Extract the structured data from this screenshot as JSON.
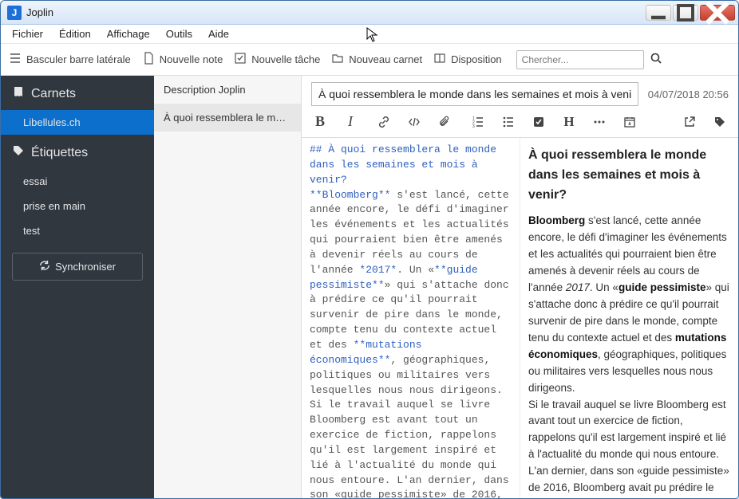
{
  "window": {
    "title": "Joplin"
  },
  "menu": {
    "file": "Fichier",
    "edit": "Édition",
    "view": "Affichage",
    "tools": "Outils",
    "help": "Aide"
  },
  "toolbar": {
    "toggle_sidebar": "Basculer barre latérale",
    "new_note": "Nouvelle note",
    "new_task": "Nouvelle tâche",
    "new_notebook": "Nouveau carnet",
    "layout": "Disposition",
    "search_placeholder": "Chercher..."
  },
  "sidebar": {
    "notebooks_label": "Carnets",
    "notebooks": [
      {
        "label": "Libellules.ch",
        "active": true
      }
    ],
    "tags_label": "Étiquettes",
    "tags": [
      {
        "label": "essai"
      },
      {
        "label": "prise en main"
      },
      {
        "label": "test"
      }
    ],
    "sync_label": "Synchroniser"
  },
  "notelist": {
    "items": [
      {
        "label": "Description Joplin",
        "selected": false
      },
      {
        "label": "À quoi ressemblera le monde dans",
        "selected": true
      }
    ]
  },
  "note": {
    "title": "À quoi ressemblera le monde dans les semaines et mois à venir?",
    "timestamp": "04/07/2018 20:56",
    "md_heading": "## À quoi ressemblera le monde dans les semaines et mois à venir?",
    "md_line1a": "**Bloomberg**",
    "md_line1b": " s'est lancé, cette année encore, le défi d'imaginer les événements et les actualités qui pourraient bien être amenés à devenir réels au cours de l'année ",
    "md_line1c": "*2017*",
    "md_line1d": ". Un «",
    "md_line1e": "**guide pessimiste**",
    "md_line1f": "» qui s'attache donc à prédire ce qu'il pourrait survenir de pire dans le monde, compte tenu du contexte actuel et des ",
    "md_line1g": "**mutations économiques**",
    "md_line1h": ", géographiques, politiques ou militaires vers lesquelles nous nous dirigeons.",
    "md_line2": "Si le travail auquel se livre Bloomberg est avant tout un exercice de fiction, rappelons qu'il est largement inspiré et lié à l'actualité du monde qui nous entoure. L'an dernier, dans son «guide pessimiste» de 2016,",
    "r_heading": "À quoi ressemblera le monde dans les semaines et mois à venir?",
    "r_p1_a": "Bloomberg",
    "r_p1_b": " s'est lancé, cette année encore, le défi d'imaginer les événements et les actualités qui pourraient bien être amenés à devenir réels au cours de l'année ",
    "r_p1_c": "2017",
    "r_p1_d": ". Un «",
    "r_p1_e": "guide pessimiste",
    "r_p1_f": "» qui s'attache donc à prédire ce qu'il pourrait survenir de pire dans le monde, compte tenu du contexte actuel et des ",
    "r_p1_g": "mutations économiques",
    "r_p1_h": ", géographiques, politiques ou militaires vers lesquelles nous nous dirigeons.",
    "r_p2": "Si le travail auquel se livre Bloomberg est avant tout un exercice de fiction, rappelons qu'il est largement inspiré et lié à l'actualité du monde qui nous entoure. L'an dernier, dans son «guide pessimiste» de 2016, Bloomberg avait pu prédire le"
  }
}
